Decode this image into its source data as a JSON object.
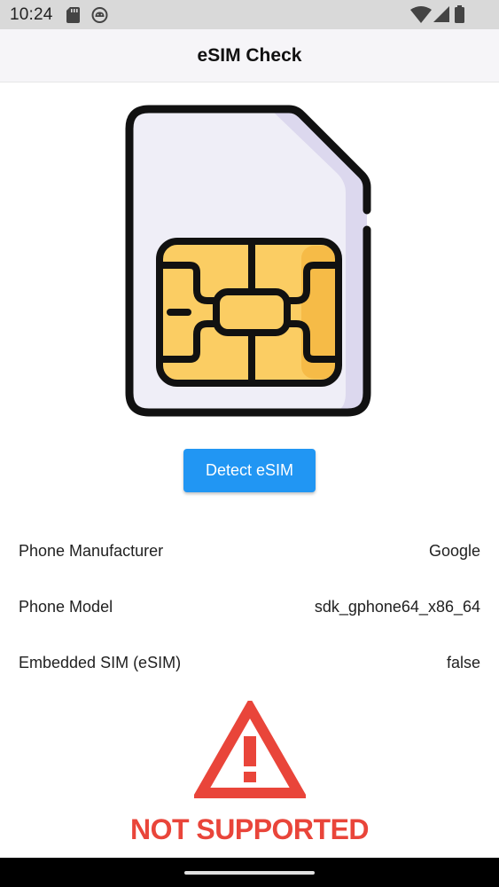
{
  "status_bar": {
    "time": "10:24",
    "left_icons": [
      "sd-card-icon",
      "android-debug-icon"
    ],
    "right_icons": [
      "wifi-icon",
      "signal-icon",
      "battery-icon"
    ]
  },
  "app_bar": {
    "title": "eSIM Check"
  },
  "illustration": {
    "icon": "sim-card-icon"
  },
  "detect_button": {
    "label": "Detect eSIM",
    "color": "#2196f3"
  },
  "info_rows": [
    {
      "label": "Phone Manufacturer",
      "value": "Google"
    },
    {
      "label": "Phone Model",
      "value": "sdk_gphone64_x86_64"
    },
    {
      "label": "Embedded SIM (eSIM)",
      "value": "false"
    }
  ],
  "result": {
    "icon": "warning-triangle-icon",
    "text": "NOT SUPPORTED",
    "color": "#e9453a"
  }
}
